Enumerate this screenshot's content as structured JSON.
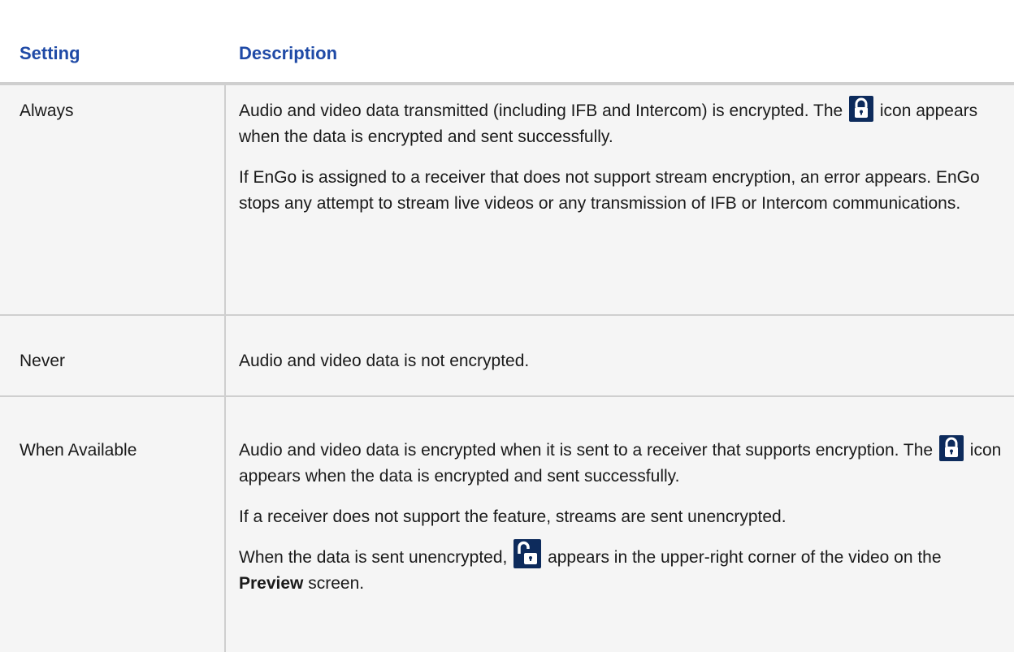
{
  "header": {
    "setting": "Setting",
    "description": "Description"
  },
  "rows": [
    {
      "setting": "Always",
      "p1_a": "Audio and video data transmitted (including IFB and Intercom) is encrypted.  The",
      "p1_b": "icon appears when the data is encrypted and sent successfully.",
      "p2": "If EnGo is assigned to a receiver that does not support stream encryption, an error appears. EnGo stops any attempt to stream live videos or any transmission of IFB or Intercom communications."
    },
    {
      "setting": "Never",
      "p1": "Audio and video data is not encrypted."
    },
    {
      "setting": "When Available",
      "p1_a": "Audio and video data is encrypted when it is sent to a receiver that supports encryption.  The",
      "p1_b": "icon appears when the data is encrypted and sent successfully.",
      "p2": "If a receiver does not support the feature, streams are sent unencrypted.",
      "p3_a": "When the data is sent unencrypted,",
      "p3_b": "appears in the upper-right corner of the video on the",
      "p3_bold": "Preview",
      "p3_c": "screen."
    }
  ],
  "icons": {
    "lock": "lock-icon",
    "unlock": "unlock-icon",
    "color": "#0d2b5c",
    "header_color": "#1f4aa6",
    "row_bg": "#f5f5f5"
  }
}
